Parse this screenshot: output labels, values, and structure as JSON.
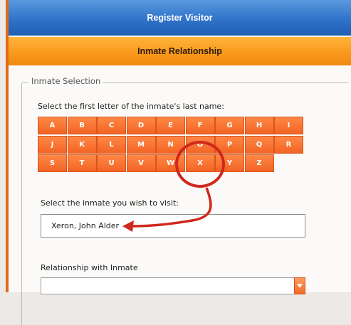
{
  "window": {
    "title": "Register Visitor"
  },
  "section": {
    "title": "Inmate Relationship"
  },
  "inmate_selection": {
    "legend": "Inmate Selection",
    "letter_prompt": "Select the first letter of the inmate's last name:",
    "letters": [
      "A",
      "B",
      "C",
      "D",
      "E",
      "F",
      "G",
      "H",
      "I",
      "J",
      "K",
      "L",
      "M",
      "N",
      "O",
      "P",
      "Q",
      "R",
      "S",
      "T",
      "U",
      "V",
      "W",
      "X",
      "Y",
      "Z"
    ],
    "selected_letter": "X",
    "inmate_prompt": "Select the inmate you wish to visit:",
    "inmate_value": "Xeron, John Alder"
  },
  "relationship": {
    "label": "Relationship with Inmate",
    "value": ""
  },
  "annotation": {
    "color": "#d0281c"
  }
}
